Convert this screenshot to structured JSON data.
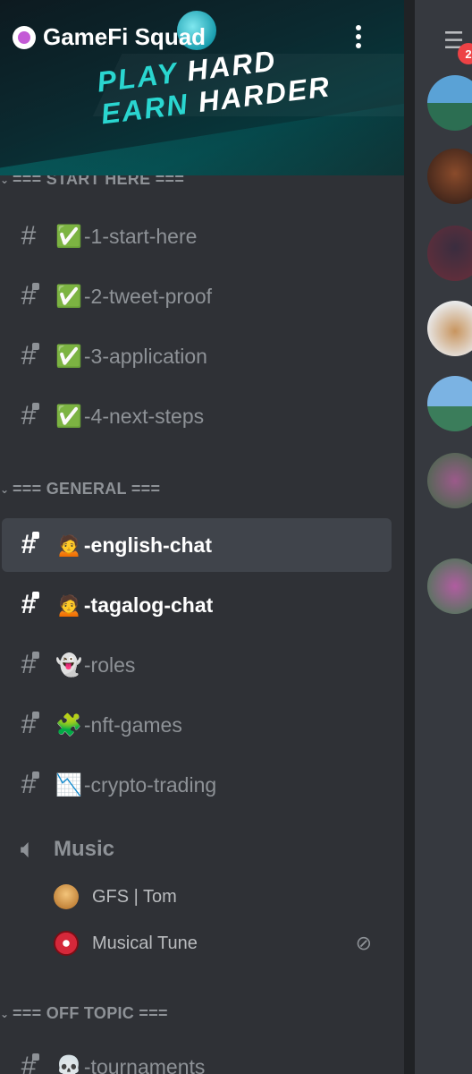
{
  "server": {
    "name": "GameFi Squad",
    "tagline_line1": "PLAY HARD",
    "tagline_line2": "EARN HARDER"
  },
  "categories": [
    {
      "label": "=== START HERE ==="
    },
    {
      "label": "=== GENERAL ==="
    },
    {
      "label": "=== OFF TOPIC ==="
    }
  ],
  "start_channels": [
    {
      "emoji": "✅",
      "name": "-1-start-here",
      "locked": false
    },
    {
      "emoji": "✅",
      "name": "-2-tweet-proof",
      "locked": true
    },
    {
      "emoji": "✅",
      "name": "-3-application",
      "locked": true
    },
    {
      "emoji": "✅",
      "name": "-4-next-steps",
      "locked": true
    }
  ],
  "general_channels": [
    {
      "emoji": "🙍",
      "name": "-english-chat",
      "state": "active"
    },
    {
      "emoji": "🙍",
      "name": "-tagalog-chat",
      "state": "unread"
    },
    {
      "emoji": "👻",
      "name": "-roles",
      "state": "normal"
    },
    {
      "emoji": "🧩",
      "name": "-nft-games",
      "state": "normal"
    },
    {
      "emoji": "📉",
      "name": "-crypto-trading",
      "state": "normal"
    }
  ],
  "voice_channel": {
    "name": "Music",
    "members": [
      {
        "name": "GFS | Tom"
      },
      {
        "name": "Musical Tune"
      }
    ]
  },
  "off_topic_channels": [
    {
      "emoji": "💀",
      "name": "-tournaments"
    }
  ],
  "member_rail": {
    "badge_count": "2"
  },
  "colors": {
    "background": "#2f3136",
    "active_channel": "#40444b",
    "muted_text": "#8e9297",
    "badge": "#ed4245",
    "accent_cyan": "#2ad6d0"
  }
}
